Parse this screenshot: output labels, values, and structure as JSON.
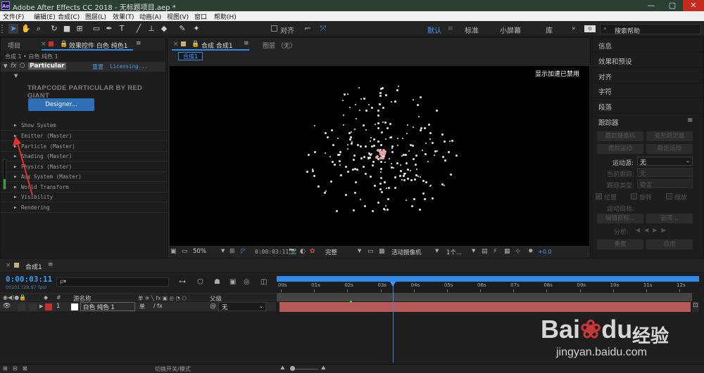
{
  "titlebar": {
    "logo": "Ae",
    "title": "Adobe After Effects CC 2018 - 无标题项目.aep *",
    "min": "—",
    "max": "▢",
    "close": "✕"
  },
  "menu": [
    "文件(F)",
    "编辑(E)",
    "合成(C)",
    "图层(L)",
    "效果(T)",
    "动画(A)",
    "视图(V)",
    "窗口",
    "帮助(H)"
  ],
  "toolbar": {
    "align_label": "对齐",
    "workspaces": [
      "默认",
      "标准",
      "小屏幕",
      "库"
    ],
    "search_placeholder": "搜索帮助"
  },
  "left_panel": {
    "tab_project": "项目",
    "tab_effects": "效果控件 白色 纯色1",
    "breadcrumb": "合成 1 • 白色 纯色 1",
    "effect_name": "Particular",
    "reset": "重置",
    "licensing": "Licensing...",
    "brand": "TRAPCODE PARTICULAR BY RED GIANT",
    "designer_btn": "Designer...",
    "props": [
      "Show System",
      "Emitter (Master)",
      "Particle (Master)",
      "Shading (Master)",
      "Physics (Master)",
      "Aux System (Master)",
      "World Transform",
      "Visibility",
      "Rendering"
    ]
  },
  "viewer": {
    "tab_comp": "合成 合成1",
    "tab_layer": "图层 （无）",
    "comp_chip": "合成1",
    "accel_msg": "显示加速已禁用",
    "zoom": "50%",
    "timecode": "0:00:03:11",
    "quality": "完整",
    "camera": "活动摄像机",
    "views": "1个...",
    "exposure": "+0.0"
  },
  "right_panel": {
    "items": [
      "信息",
      "效果和预设",
      "对齐",
      "字符",
      "段落"
    ],
    "tracker_title": "跟踪器",
    "track_camera": "跟踪摄像机",
    "stabilize": "变形稳定器",
    "track_motion": "跟踪运动",
    "stabilize_motion": "稳定运动",
    "motion_source_label": "运动源:",
    "motion_source_value": "无",
    "current_track_label": "当前跟踪:",
    "current_track_value": "无",
    "track_type_label": "跟踪类型:",
    "track_type_value": "稳定",
    "position": "位置",
    "rotation": "旋转",
    "scale": "缩放",
    "motion_target": "运动目标:",
    "edit_target": "编辑目标...",
    "options": "选项...",
    "analyze": "分析:",
    "reset": "重置",
    "apply": "应用"
  },
  "timeline": {
    "tab": "合成1",
    "timecode": "0:00:03:11",
    "frames": "00101 (29.97 fps)",
    "search_placeholder": "ρ▾",
    "col_source": "源名称",
    "col_parent": "父级",
    "switches_hdr": "单 ✲ ╲ fx ▣ ◎ ◔ ⬡",
    "layer_num": "1",
    "layer_name": "白色 纯色 1",
    "layer_parent": "无",
    "ticks": [
      "00s",
      "01s",
      "02s",
      "03s",
      "04s",
      "05s",
      "06s",
      "07s",
      "08s",
      "09s",
      "10s",
      "11s",
      "12s"
    ],
    "toggle_label": "切换开关/模式",
    "playhead_seconds": 3.37
  },
  "watermark": {
    "brand": "Bai",
    "paw": "du",
    "cn": "经验",
    "url": "jingyan.baidu.com"
  },
  "colors": {
    "accent": "#2d8ceb",
    "layer_bar": "#b85a5a",
    "layer_label": "#c43030",
    "title_bg": "#2a4030"
  }
}
